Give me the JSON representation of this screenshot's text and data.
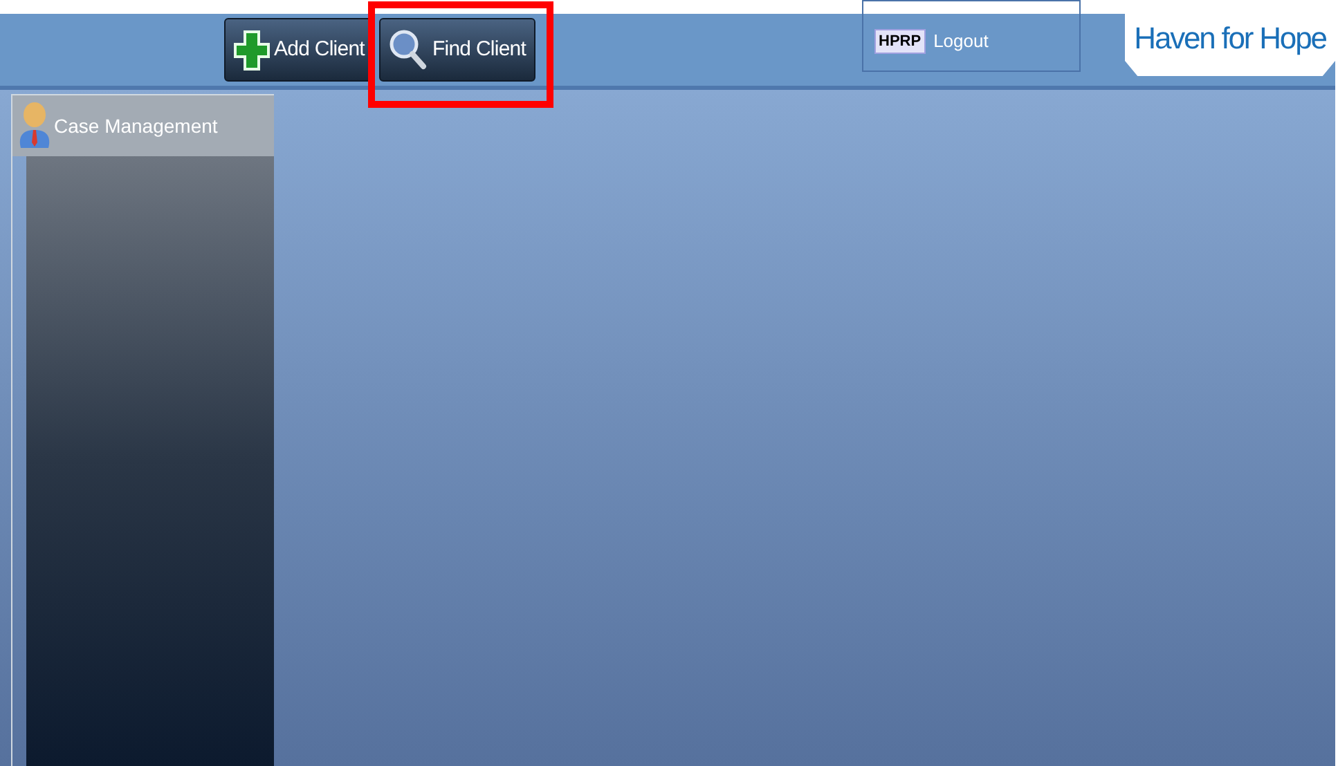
{
  "toolbar": {
    "buttons": [
      {
        "kind": "add",
        "label": "Add Client",
        "highlighted": false
      },
      {
        "kind": "find",
        "label": "Find Client",
        "highlighted": true
      }
    ]
  },
  "user_panel": {
    "badge": "HPRP",
    "link": "Logout"
  },
  "logo": {
    "text": "Haven for Hope"
  },
  "sidebar": {
    "title": "Case Management"
  }
}
